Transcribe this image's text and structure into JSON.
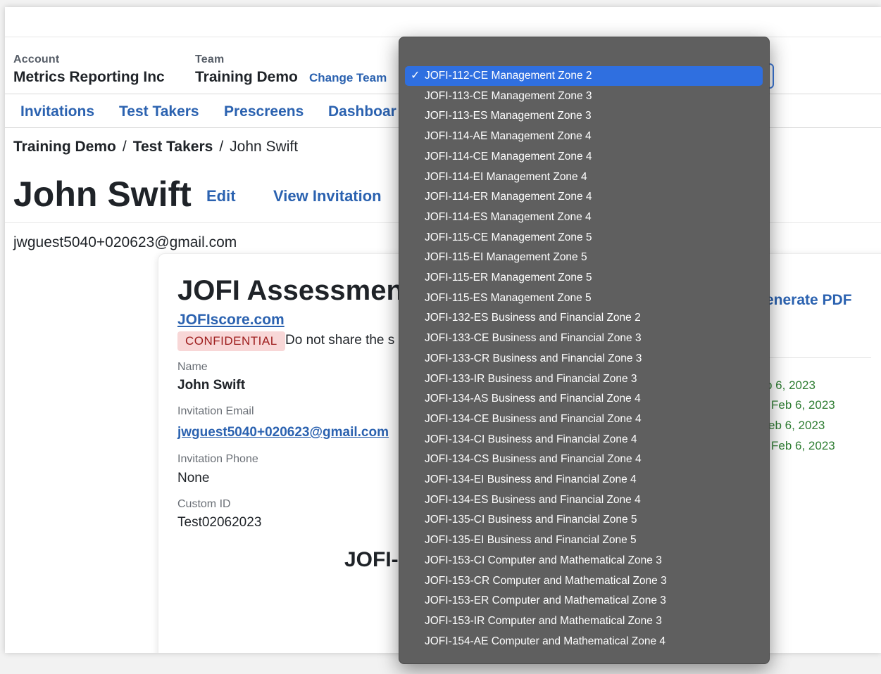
{
  "header": {
    "account_label": "Account",
    "account_name": "Metrics Reporting Inc",
    "team_label": "Team",
    "team_name": "Training Demo",
    "change_team": "Change Team"
  },
  "nav": {
    "invitations": "Invitations",
    "test_takers": "Test Takers",
    "prescreens": "Prescreens",
    "dashboard": "Dashboar"
  },
  "breadcrumb": {
    "team": "Training Demo",
    "sep": "/",
    "section": "Test Takers",
    "current": "John Swift"
  },
  "page": {
    "title": "John Swift",
    "edit": "Edit",
    "view_invitation": "View Invitation",
    "email": "jwguest5040+020623@gmail.com"
  },
  "card": {
    "title": "JOFI Assessmen",
    "site_link": "JOFIscore.com",
    "confidential": "CONFIDENTIAL",
    "notice": "Do not share the s",
    "name_label": "Name",
    "name_value": "John Swift",
    "inv_email_label": "Invitation Email",
    "inv_email_value": "jwguest5040+020623@gmail.com",
    "inv_phone_label": "Invitation Phone",
    "inv_phone_value": "None",
    "custom_id_label": "Custom ID",
    "custom_id_value": "Test02062023",
    "section_heading": "JOFI-",
    "generate_pdf": "enerate PDF",
    "dates": [
      "b 6, 2023",
      "Feb 6, 2023",
      "eb 6, 2023",
      "Feb 6, 2023"
    ]
  },
  "dropdown": {
    "selected_index": 0,
    "check_glyph": "✓",
    "options": [
      "JOFI-112-CE Management Zone 2",
      "JOFI-113-CE Management Zone 3",
      "JOFI-113-ES Management Zone 3",
      "JOFI-114-AE Management Zone 4",
      "JOFI-114-CE Management Zone 4",
      "JOFI-114-EI Management Zone 4",
      "JOFI-114-ER Management Zone 4",
      "JOFI-114-ES Management Zone 4",
      "JOFI-115-CE Management Zone 5",
      "JOFI-115-EI Management Zone 5",
      "JOFI-115-ER Management Zone 5",
      "JOFI-115-ES Management Zone 5",
      "JOFI-132-ES Business and Financial Zone 2",
      "JOFI-133-CE Business and Financial Zone 3",
      "JOFI-133-CR Business and Financial Zone 3",
      "JOFI-133-IR Business and Financial Zone 3",
      "JOFI-134-AS Business and Financial Zone 4",
      "JOFI-134-CE Business and Financial Zone 4",
      "JOFI-134-CI Business and Financial Zone 4",
      "JOFI-134-CS Business and Financial Zone 4",
      "JOFI-134-EI Business and Financial Zone 4",
      "JOFI-134-ES Business and Financial Zone 4",
      "JOFI-135-CI Business and Financial Zone 5",
      "JOFI-135-EI Business and Financial Zone 5",
      "JOFI-153-CI Computer and Mathematical Zone 3",
      "JOFI-153-CR Computer and Mathematical Zone 3",
      "JOFI-153-ER Computer and Mathematical Zone 3",
      "JOFI-153-IR Computer and Mathematical Zone 3",
      "JOFI-154-AE Computer and Mathematical Zone 4"
    ]
  },
  "colors": {
    "link": "#2b62b0",
    "dropdown_bg": "#5f5f5f",
    "selected": "#2f6fe0",
    "date_green": "#2e7d32",
    "badge_bg": "#f8d7d7"
  }
}
